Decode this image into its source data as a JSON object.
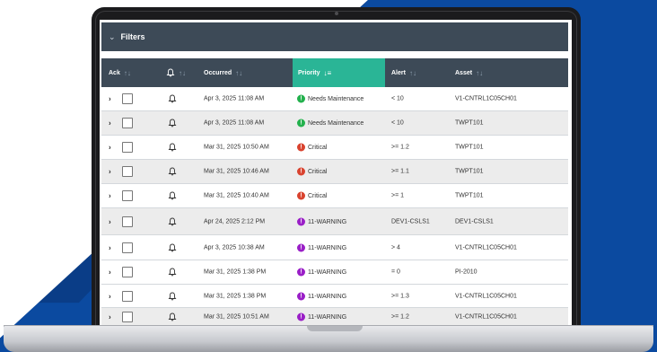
{
  "filters": {
    "label": "Filters"
  },
  "table": {
    "headers": {
      "ack": "Ack",
      "occurred": "Occurred",
      "priority": "Priority",
      "alert": "Alert",
      "asset": "Asset"
    },
    "rows": [
      {
        "occurred": "Apr 3, 2025 11:08 AM",
        "priority": "Needs Maintenance",
        "priority_color": "#23b14d",
        "priority_icon": "!",
        "alert": "< 10",
        "asset": "V1-CNTRL1C05CH01"
      },
      {
        "occurred": "Apr 3, 2025 11:08 AM",
        "priority": "Needs Maintenance",
        "priority_color": "#23b14d",
        "priority_icon": "!",
        "alert": "< 10",
        "asset": "TWPT101"
      },
      {
        "occurred": "Mar 31, 2025 10:50 AM",
        "priority": "Critical",
        "priority_color": "#d9432f",
        "priority_icon": "!",
        "alert": ">= 1.2",
        "asset": "TWPT101"
      },
      {
        "occurred": "Mar 31, 2025 10:46 AM",
        "priority": "Critical",
        "priority_color": "#d9432f",
        "priority_icon": "!",
        "alert": ">= 1.1",
        "asset": "TWPT101"
      },
      {
        "occurred": "Mar 31, 2025 10:40 AM",
        "priority": "Critical",
        "priority_color": "#d9432f",
        "priority_icon": "!",
        "alert": ">= 1",
        "asset": "TWPT101"
      },
      {
        "occurred": "Apr 24, 2025 2:12 PM",
        "priority": "11-WARNING",
        "priority_color": "#9a1fc7",
        "priority_icon": "!",
        "alert": "DEV1-CSLS1",
        "asset": "DEV1-CSLS1"
      },
      {
        "occurred": "Apr 3, 2025 10:38 AM",
        "priority": "11-WARNING",
        "priority_color": "#9a1fc7",
        "priority_icon": "!",
        "alert": "> 4",
        "asset": "V1-CNTRL1C05CH01"
      },
      {
        "occurred": "Mar 31, 2025 1:38 PM",
        "priority": "11-WARNING",
        "priority_color": "#9a1fc7",
        "priority_icon": "!",
        "alert": "= 0",
        "asset": "PI-2010"
      },
      {
        "occurred": "Mar 31, 2025 1:38 PM",
        "priority": "11-WARNING",
        "priority_color": "#9a1fc7",
        "priority_icon": "!",
        "alert": ">= 1.3",
        "asset": "V1-CNTRL1C05CH01"
      },
      {
        "occurred": "Mar 31, 2025 10:51 AM",
        "priority": "11-WARNING",
        "priority_color": "#9a1fc7",
        "priority_icon": "!",
        "alert": ">= 1.2",
        "asset": "V1-CNTRL1C05CH01"
      }
    ]
  }
}
